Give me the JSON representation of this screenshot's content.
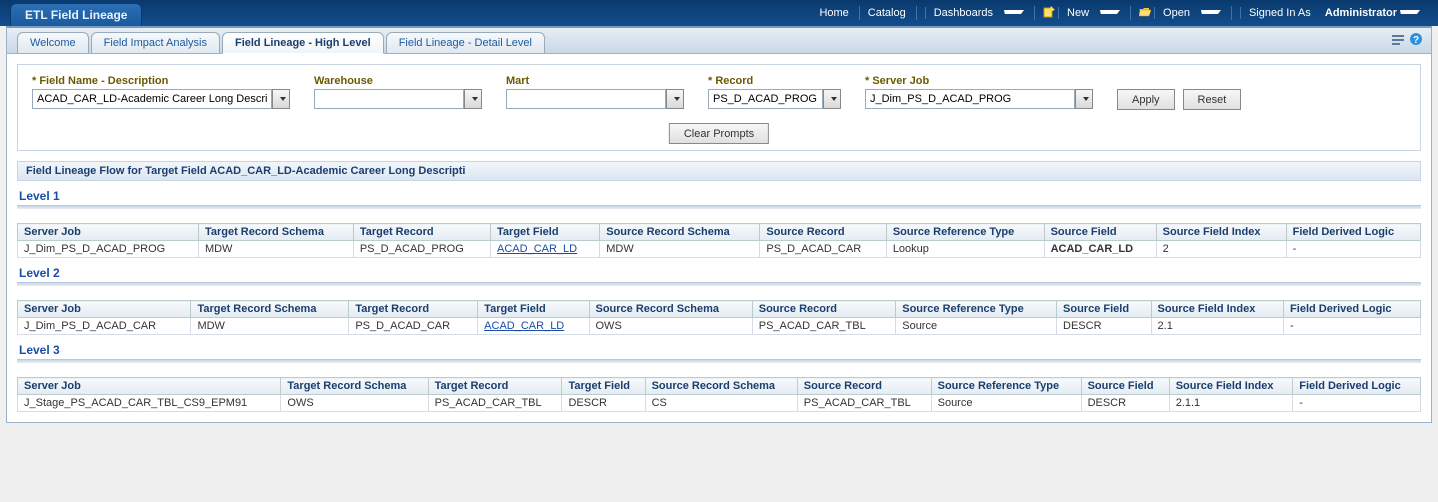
{
  "app_title": "ETL Field Lineage",
  "topnav": {
    "home": "Home",
    "catalog": "Catalog",
    "dashboards": "Dashboards",
    "new": "New",
    "open": "Open",
    "signed_prefix": "Signed In As",
    "user": "Administrator"
  },
  "tabs": {
    "welcome": "Welcome",
    "impact": "Field Impact Analysis",
    "high": "Field Lineage - High Level",
    "detail": "Field Lineage - Detail Level"
  },
  "prompts": {
    "field_name": {
      "label": "* Field Name - Description",
      "value": "ACAD_CAR_LD-Academic Career Long Descripti"
    },
    "warehouse": {
      "label": "Warehouse",
      "value": ""
    },
    "mart": {
      "label": "Mart",
      "value": ""
    },
    "record": {
      "label": "* Record",
      "value": "PS_D_ACAD_PROG"
    },
    "server_job": {
      "label": "* Server Job",
      "value": "J_Dim_PS_D_ACAD_PROG"
    },
    "apply": "Apply",
    "reset": "Reset",
    "clear": "Clear Prompts"
  },
  "section_header": "Field Lineage Flow for Target Field ACAD_CAR_LD-Academic Career Long Descripti",
  "columns": [
    "Server Job",
    "Target Record Schema",
    "Target Record",
    "Target Field",
    "Source Record Schema",
    "Source Record",
    "Source Reference Type",
    "Source Field",
    "Source Field Index",
    "Field Derived Logic"
  ],
  "levels": [
    {
      "title": "Level 1",
      "rows": [
        {
          "server_job": "J_Dim_PS_D_ACAD_PROG",
          "trs": "MDW",
          "tr": "PS_D_ACAD_PROG",
          "tf": "ACAD_CAR_LD",
          "tf_link": true,
          "srs": "MDW",
          "sr": "PS_D_ACAD_CAR",
          "srt": "Lookup",
          "sf": "ACAD_CAR_LD",
          "sf_bold": true,
          "sfi": "2",
          "fdl": "-"
        }
      ]
    },
    {
      "title": "Level 2",
      "rows": [
        {
          "server_job": "J_Dim_PS_D_ACAD_CAR",
          "trs": "MDW",
          "tr": "PS_D_ACAD_CAR",
          "tf": "ACAD_CAR_LD",
          "tf_link": true,
          "srs": "OWS",
          "sr": "PS_ACAD_CAR_TBL",
          "srt": "Source",
          "sf": "DESCR",
          "sf_bold": false,
          "sfi": "2.1",
          "fdl": "-"
        }
      ]
    },
    {
      "title": "Level 3",
      "rows": [
        {
          "server_job": "J_Stage_PS_ACAD_CAR_TBL_CS9_EPM91",
          "trs": "OWS",
          "tr": "PS_ACAD_CAR_TBL",
          "tf": "DESCR",
          "tf_link": false,
          "srs": "CS",
          "sr": "PS_ACAD_CAR_TBL",
          "srt": "Source",
          "sf": "DESCR",
          "sf_bold": false,
          "sfi": "2.1.1",
          "fdl": "-"
        }
      ]
    }
  ]
}
